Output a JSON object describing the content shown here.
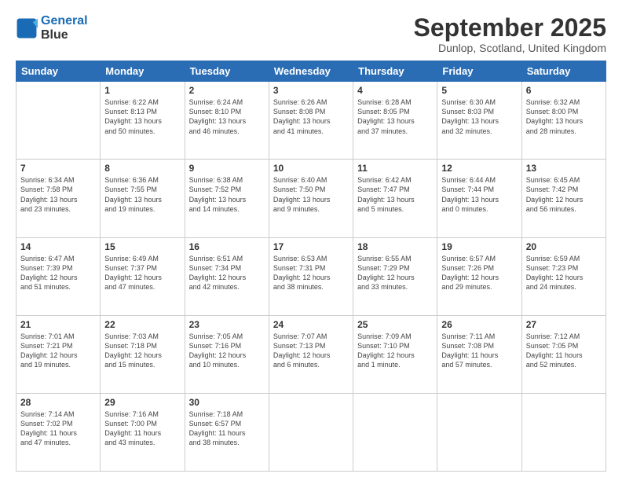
{
  "logo": {
    "line1": "General",
    "line2": "Blue"
  },
  "title": "September 2025",
  "location": "Dunlop, Scotland, United Kingdom",
  "days_of_week": [
    "Sunday",
    "Monday",
    "Tuesday",
    "Wednesday",
    "Thursday",
    "Friday",
    "Saturday"
  ],
  "weeks": [
    [
      {
        "num": "",
        "info": ""
      },
      {
        "num": "1",
        "info": "Sunrise: 6:22 AM\nSunset: 8:13 PM\nDaylight: 13 hours\nand 50 minutes."
      },
      {
        "num": "2",
        "info": "Sunrise: 6:24 AM\nSunset: 8:10 PM\nDaylight: 13 hours\nand 46 minutes."
      },
      {
        "num": "3",
        "info": "Sunrise: 6:26 AM\nSunset: 8:08 PM\nDaylight: 13 hours\nand 41 minutes."
      },
      {
        "num": "4",
        "info": "Sunrise: 6:28 AM\nSunset: 8:05 PM\nDaylight: 13 hours\nand 37 minutes."
      },
      {
        "num": "5",
        "info": "Sunrise: 6:30 AM\nSunset: 8:03 PM\nDaylight: 13 hours\nand 32 minutes."
      },
      {
        "num": "6",
        "info": "Sunrise: 6:32 AM\nSunset: 8:00 PM\nDaylight: 13 hours\nand 28 minutes."
      }
    ],
    [
      {
        "num": "7",
        "info": "Sunrise: 6:34 AM\nSunset: 7:58 PM\nDaylight: 13 hours\nand 23 minutes."
      },
      {
        "num": "8",
        "info": "Sunrise: 6:36 AM\nSunset: 7:55 PM\nDaylight: 13 hours\nand 19 minutes."
      },
      {
        "num": "9",
        "info": "Sunrise: 6:38 AM\nSunset: 7:52 PM\nDaylight: 13 hours\nand 14 minutes."
      },
      {
        "num": "10",
        "info": "Sunrise: 6:40 AM\nSunset: 7:50 PM\nDaylight: 13 hours\nand 9 minutes."
      },
      {
        "num": "11",
        "info": "Sunrise: 6:42 AM\nSunset: 7:47 PM\nDaylight: 13 hours\nand 5 minutes."
      },
      {
        "num": "12",
        "info": "Sunrise: 6:44 AM\nSunset: 7:44 PM\nDaylight: 13 hours\nand 0 minutes."
      },
      {
        "num": "13",
        "info": "Sunrise: 6:45 AM\nSunset: 7:42 PM\nDaylight: 12 hours\nand 56 minutes."
      }
    ],
    [
      {
        "num": "14",
        "info": "Sunrise: 6:47 AM\nSunset: 7:39 PM\nDaylight: 12 hours\nand 51 minutes."
      },
      {
        "num": "15",
        "info": "Sunrise: 6:49 AM\nSunset: 7:37 PM\nDaylight: 12 hours\nand 47 minutes."
      },
      {
        "num": "16",
        "info": "Sunrise: 6:51 AM\nSunset: 7:34 PM\nDaylight: 12 hours\nand 42 minutes."
      },
      {
        "num": "17",
        "info": "Sunrise: 6:53 AM\nSunset: 7:31 PM\nDaylight: 12 hours\nand 38 minutes."
      },
      {
        "num": "18",
        "info": "Sunrise: 6:55 AM\nSunset: 7:29 PM\nDaylight: 12 hours\nand 33 minutes."
      },
      {
        "num": "19",
        "info": "Sunrise: 6:57 AM\nSunset: 7:26 PM\nDaylight: 12 hours\nand 29 minutes."
      },
      {
        "num": "20",
        "info": "Sunrise: 6:59 AM\nSunset: 7:23 PM\nDaylight: 12 hours\nand 24 minutes."
      }
    ],
    [
      {
        "num": "21",
        "info": "Sunrise: 7:01 AM\nSunset: 7:21 PM\nDaylight: 12 hours\nand 19 minutes."
      },
      {
        "num": "22",
        "info": "Sunrise: 7:03 AM\nSunset: 7:18 PM\nDaylight: 12 hours\nand 15 minutes."
      },
      {
        "num": "23",
        "info": "Sunrise: 7:05 AM\nSunset: 7:16 PM\nDaylight: 12 hours\nand 10 minutes."
      },
      {
        "num": "24",
        "info": "Sunrise: 7:07 AM\nSunset: 7:13 PM\nDaylight: 12 hours\nand 6 minutes."
      },
      {
        "num": "25",
        "info": "Sunrise: 7:09 AM\nSunset: 7:10 PM\nDaylight: 12 hours\nand 1 minute."
      },
      {
        "num": "26",
        "info": "Sunrise: 7:11 AM\nSunset: 7:08 PM\nDaylight: 11 hours\nand 57 minutes."
      },
      {
        "num": "27",
        "info": "Sunrise: 7:12 AM\nSunset: 7:05 PM\nDaylight: 11 hours\nand 52 minutes."
      }
    ],
    [
      {
        "num": "28",
        "info": "Sunrise: 7:14 AM\nSunset: 7:02 PM\nDaylight: 11 hours\nand 47 minutes."
      },
      {
        "num": "29",
        "info": "Sunrise: 7:16 AM\nSunset: 7:00 PM\nDaylight: 11 hours\nand 43 minutes."
      },
      {
        "num": "30",
        "info": "Sunrise: 7:18 AM\nSunset: 6:57 PM\nDaylight: 11 hours\nand 38 minutes."
      },
      {
        "num": "",
        "info": ""
      },
      {
        "num": "",
        "info": ""
      },
      {
        "num": "",
        "info": ""
      },
      {
        "num": "",
        "info": ""
      }
    ]
  ]
}
